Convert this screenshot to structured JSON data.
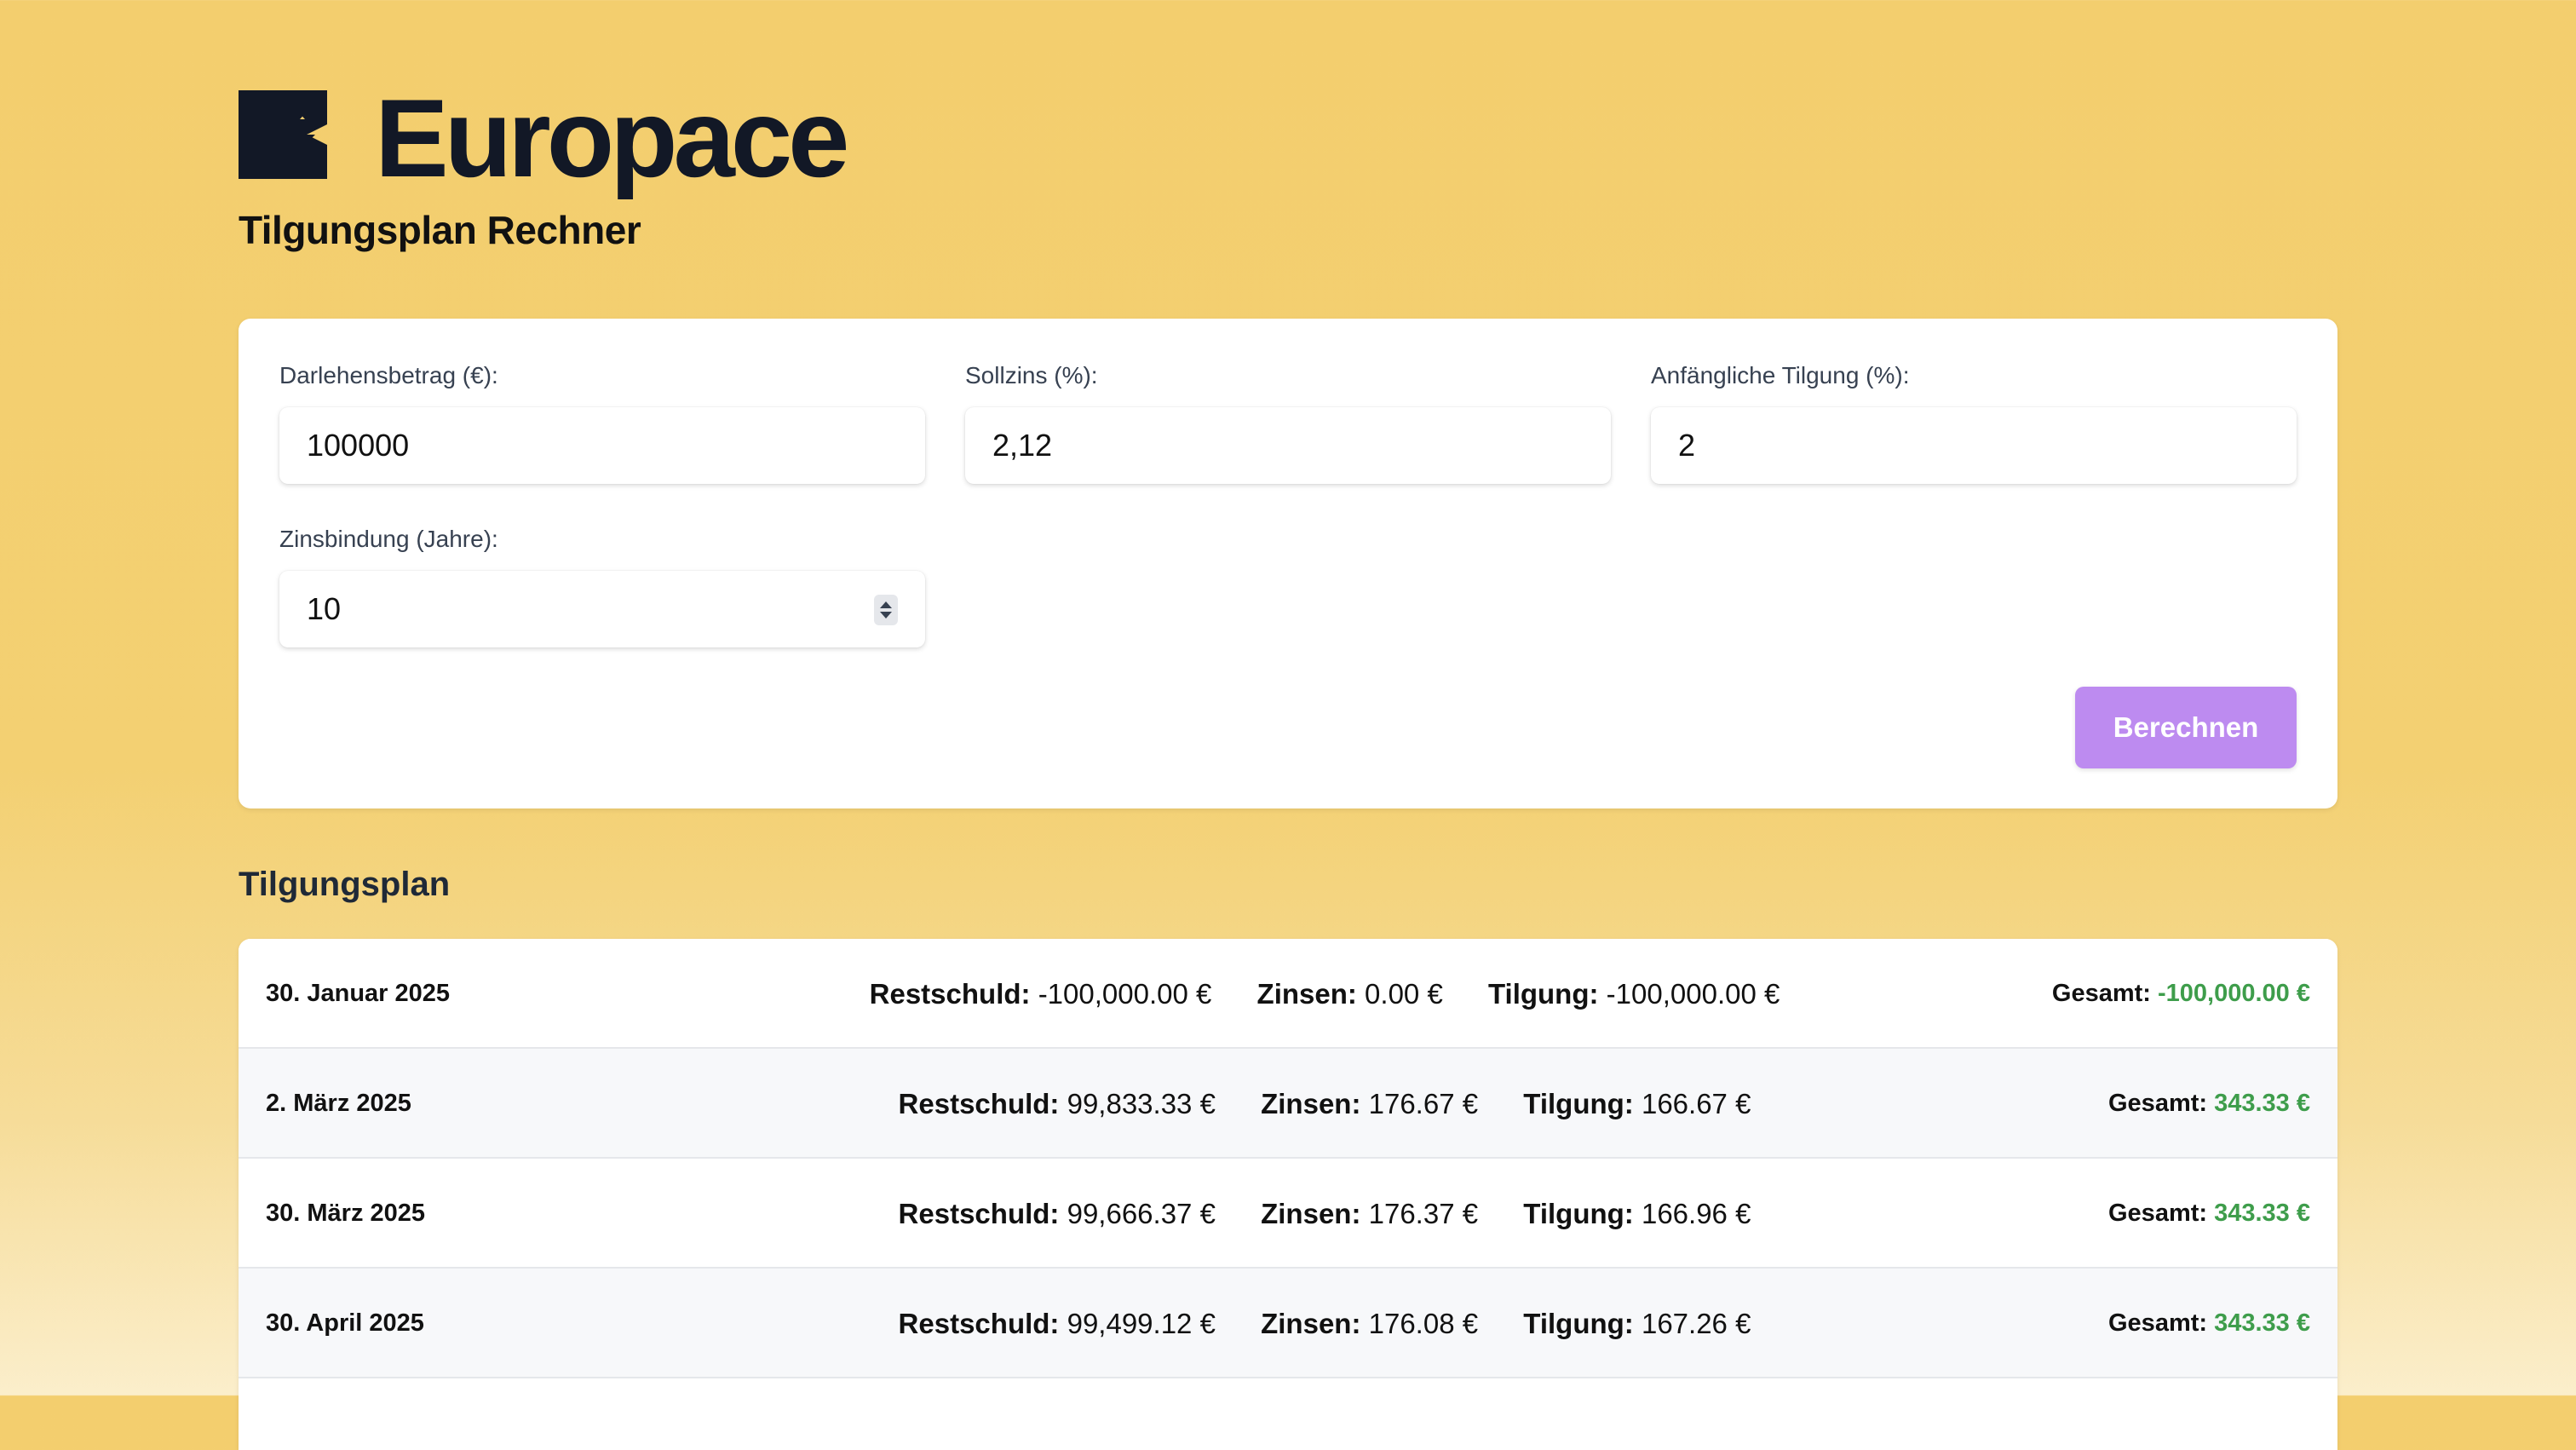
{
  "brand": {
    "name": "Europace",
    "color": "#121826"
  },
  "page": {
    "title": "Tilgungsplan Rechner"
  },
  "form": {
    "darlehensbetrag": {
      "label": "Darlehensbetrag (€):",
      "value": "100000"
    },
    "sollzins": {
      "label": "Sollzins (%):",
      "value": "2,12"
    },
    "tilgung": {
      "label": "Anfängliche Tilgung (%):",
      "value": "2"
    },
    "zinsbindung": {
      "label": "Zinsbindung (Jahre):",
      "value": "10"
    },
    "submit_label": "Berechnen",
    "submit_color": "#bd8bf0"
  },
  "schedule": {
    "title": "Tilgungsplan",
    "labels": {
      "restschuld": "Restschuld:",
      "zinsen": "Zinsen:",
      "tilgung": "Tilgung:",
      "gesamt": "Gesamt:"
    },
    "rows": [
      {
        "date": "30. Januar 2025",
        "restschuld": "-100,000.00 €",
        "zinsen": "0.00 €",
        "tilgung": "-100,000.00 €",
        "gesamt": "-100,000.00 €"
      },
      {
        "date": "2. März 2025",
        "restschuld": "99,833.33 €",
        "zinsen": "176.67 €",
        "tilgung": "166.67 €",
        "gesamt": "343.33 €"
      },
      {
        "date": "30. März 2025",
        "restschuld": "99,666.37 €",
        "zinsen": "176.37 €",
        "tilgung": "166.96 €",
        "gesamt": "343.33 €"
      },
      {
        "date": "30. April 2025",
        "restschuld": "99,499.12 €",
        "zinsen": "176.08 €",
        "tilgung": "167.26 €",
        "gesamt": "343.33 €"
      },
      {
        "date": "",
        "restschuld": "",
        "zinsen": "",
        "tilgung": "",
        "gesamt": ""
      }
    ],
    "total_color": "#3e9d4b"
  }
}
